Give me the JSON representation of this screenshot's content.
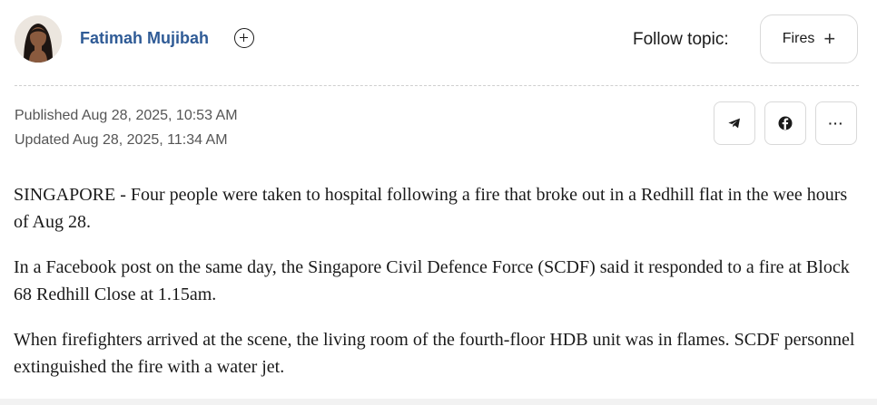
{
  "author": {
    "name": "Fatimah Mujibah",
    "follow_icon": "plus-circle-icon"
  },
  "topic": {
    "label": "Follow topic:",
    "chip_label": "Fires",
    "chip_icon": "plus-icon"
  },
  "meta": {
    "published": "Published Aug 28, 2025, 10:53 AM",
    "updated": "Updated Aug 28, 2025, 11:34 AM"
  },
  "share": {
    "icons": [
      "telegram-icon",
      "facebook-icon",
      "more-icon"
    ],
    "more_label": "···"
  },
  "article": {
    "paragraphs": [
      "SINGAPORE - Four people were taken to hospital following a fire that broke out in a Redhill flat in the wee hours of Aug 28.",
      "In a Facebook post on the same day, the Singapore Civil Defence Force (SCDF) said it responded to a fire at Block 68 Redhill Close at 1.15am.",
      "When firefighters arrived at the scene, the living room of the fourth-floor HDB unit was in flames. SCDF personnel extinguished the fire with a water jet."
    ]
  },
  "colors": {
    "author_link": "#2f5b96",
    "text": "#1a1a1a",
    "meta_text": "#555555",
    "border": "#d9d9d9"
  }
}
